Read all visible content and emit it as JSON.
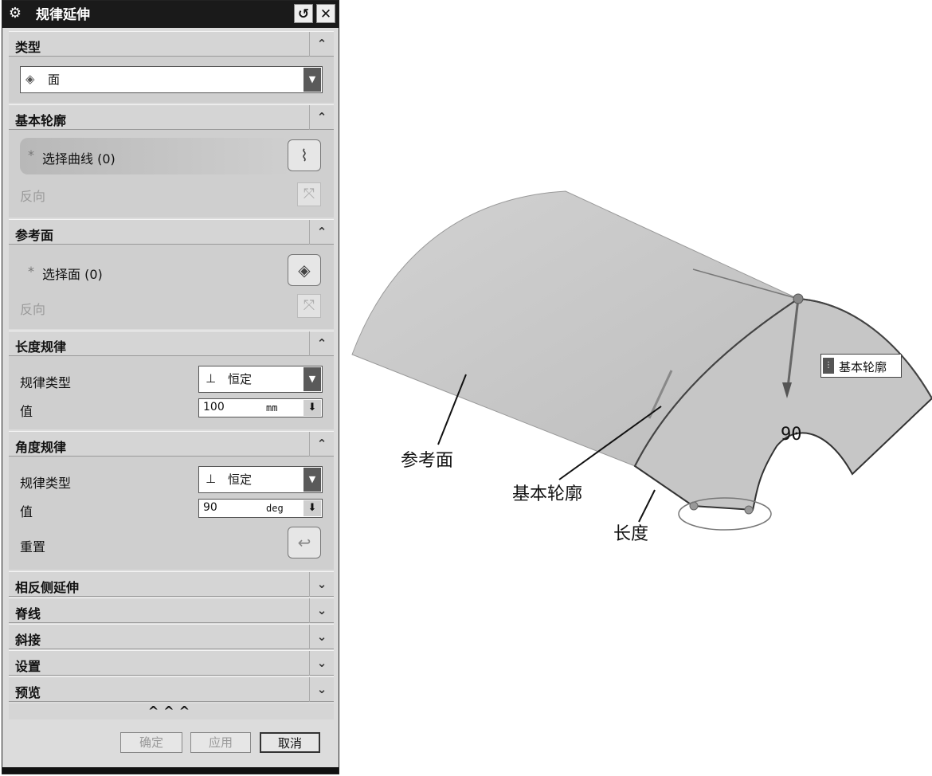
{
  "dialog": {
    "title": "规律延伸",
    "sections": {
      "type": {
        "label": "类型",
        "select_value": "面"
      },
      "base_profile": {
        "label": "基本轮廓",
        "select_curve": "选择曲线 (0)",
        "reverse": "反向"
      },
      "reference": {
        "label": "参考面",
        "select_face": "选择面 (0)",
        "reverse": "反向"
      },
      "length_law": {
        "label": "长度规律",
        "law_type_label": "规律类型",
        "law_type_value": "恒定",
        "value_label": "值",
        "value": "100",
        "unit": "mm"
      },
      "angle_law": {
        "label": "角度规律",
        "law_type_label": "规律类型",
        "law_type_value": "恒定",
        "value_label": "值",
        "value": "90",
        "unit": "deg",
        "reset_label": "重置"
      },
      "collapsed": [
        "相反侧延伸",
        "脊线",
        "斜接",
        "设置",
        "预览"
      ]
    },
    "more_indicator": "^^^",
    "buttons": {
      "ok": "确定",
      "apply": "应用",
      "cancel": "取消"
    }
  },
  "viewport": {
    "angle_value": "90",
    "tooltip": "基本轮廓",
    "annotations": {
      "reference_face": "参考面",
      "base_profile": "基本轮廓",
      "length": "长度"
    }
  }
}
